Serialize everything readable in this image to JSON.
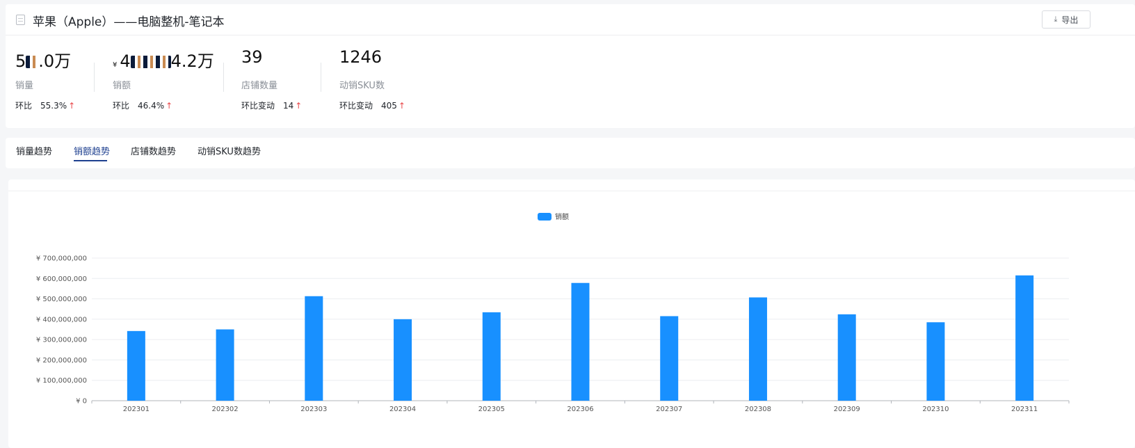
{
  "header": {
    "title": "苹果（Apple）——电脑整机-笔记本",
    "export_label": "导出",
    "export_icon": "download-icon"
  },
  "kpis": [
    {
      "value_prefix": "5",
      "value_suffix": ".0万",
      "currency": "",
      "label": "销量",
      "change_label": "环比",
      "change_value": "55.3%"
    },
    {
      "value_prefix": "4",
      "value_suffix": "4.2万",
      "currency": "¥",
      "label": "销额",
      "change_label": "环比",
      "change_value": "46.4%"
    },
    {
      "value_prefix": "39",
      "value_suffix": "",
      "currency": "",
      "label": "店铺数量",
      "change_label": "环比变动",
      "change_value": "14"
    },
    {
      "value_prefix": "1246",
      "value_suffix": "",
      "currency": "",
      "label": "动销SKU数",
      "change_label": "环比变动",
      "change_value": "405"
    }
  ],
  "arrow_up_glyph": "↑",
  "tabs": [
    {
      "label": "销量趋势",
      "active": false
    },
    {
      "label": "销额趋势",
      "active": true
    },
    {
      "label": "店铺数趋势",
      "active": false
    },
    {
      "label": "动销SKU数趋势",
      "active": false
    }
  ],
  "colors": {
    "accent": "#1d3f8f",
    "bar": "#1890ff",
    "up": "#e8484a"
  },
  "chart_data": {
    "type": "bar",
    "legend": [
      "销额"
    ],
    "legend_placement": "top-center",
    "categories": [
      "202301",
      "202302",
      "202303",
      "202304",
      "202305",
      "202306",
      "202307",
      "202308",
      "202309",
      "202310",
      "202311"
    ],
    "series": [
      {
        "name": "销额",
        "values": [
          342000000,
          350000000,
          513000000,
          400000000,
          434000000,
          578000000,
          415000000,
          507000000,
          424000000,
          385000000,
          615000000
        ]
      }
    ],
    "ylim": [
      0,
      700000000
    ],
    "yticks": [
      0,
      100000000,
      200000000,
      300000000,
      400000000,
      500000000,
      600000000,
      700000000
    ],
    "ytick_labels": [
      "¥ 0",
      "¥ 100,000,000",
      "¥ 200,000,000",
      "¥ 300,000,000",
      "¥ 400,000,000",
      "¥ 500,000,000",
      "¥ 600,000,000",
      "¥ 700,000,000"
    ],
    "grid": true
  }
}
